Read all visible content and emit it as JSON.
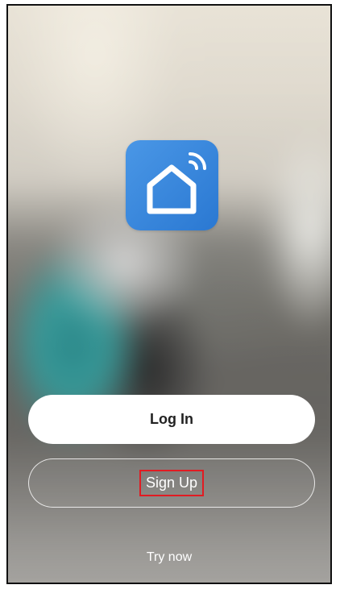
{
  "app": {
    "icon_name": "smart-home-icon",
    "accent_color": "#2a78d2"
  },
  "buttons": {
    "login_label": "Log In",
    "signup_label": "Sign Up",
    "try_now_label": "Try now"
  },
  "highlight": {
    "color": "#e11b22",
    "target": "Sign Up"
  }
}
